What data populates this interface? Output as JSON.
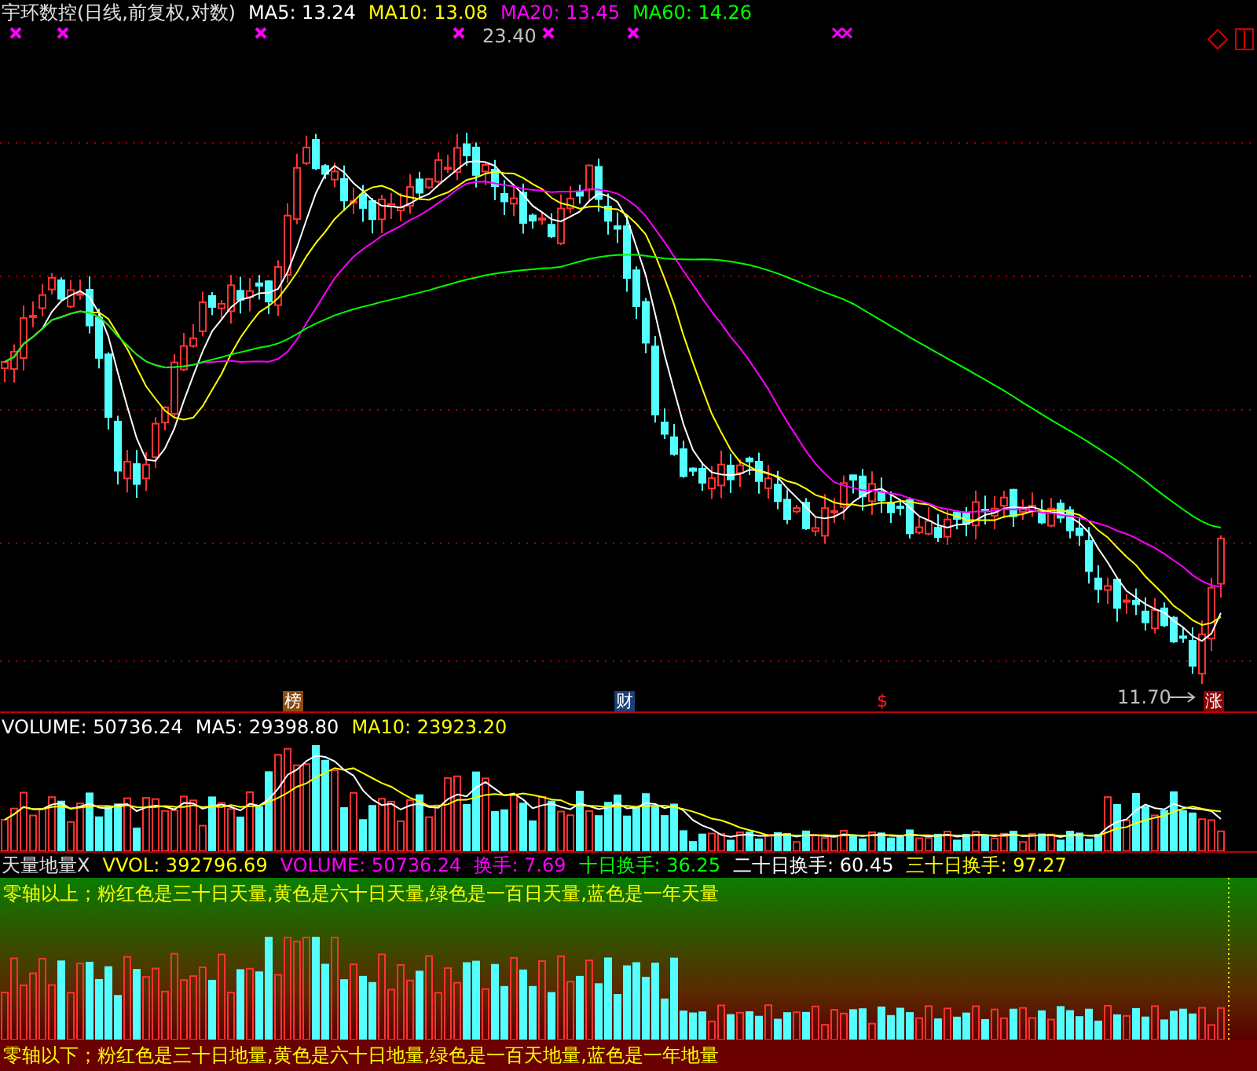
{
  "header": {
    "title": "宇环数控(日线,前复权,对数)",
    "indicators": [
      {
        "label": "MA5: 13.24",
        "color": "#ffffff"
      },
      {
        "label": "MA10: 13.08",
        "color": "#ffff00"
      },
      {
        "label": "MA20: 13.45",
        "color": "#ff00ff"
      },
      {
        "label": "MA60: 14.26",
        "color": "#00ff00"
      }
    ]
  },
  "price_chart": {
    "high_label": "23.40",
    "low_label": "11.70",
    "event_tags": [
      {
        "text": "榜",
        "kind": "boxed",
        "color": "#8b4a10"
      },
      {
        "text": "财",
        "kind": "boxed",
        "color": "#1c3f7a"
      },
      {
        "text": "$",
        "kind": "plain",
        "color": "#ff2020"
      },
      {
        "text": "涨",
        "kind": "boxed",
        "color": "#8b0000"
      }
    ]
  },
  "volume_panel": {
    "indicators": [
      {
        "label": "VOLUME: 50736.24",
        "color": "#ffffff"
      },
      {
        "label": "MA5: 29398.80",
        "color": "#ffffff"
      },
      {
        "label": "MA10: 23923.20",
        "color": "#ffff00"
      }
    ]
  },
  "indicator_panel": {
    "name": "天量地量X",
    "indicators": [
      {
        "label": "VVOL: 392796.69",
        "color": "#ffff00"
      },
      {
        "label": "VOLUME: 50736.24",
        "color": "#ff00ff"
      },
      {
        "label": "换手: 7.69",
        "color": "#ff00ff"
      },
      {
        "label": "十日换手: 36.25",
        "color": "#00ff00"
      },
      {
        "label": "二十日换手: 60.45",
        "color": "#ffffff"
      },
      {
        "label": "三十日换手: 97.27",
        "color": "#ffff00"
      }
    ],
    "top_note": "零轴以上；粉红色是三十日天量,黄色是六十日天量,绿色是一百日天量,蓝色是一年天量",
    "bottom_note": "零轴以下；粉红色是三十日地量,黄色是六十日地量,绿色是一百天地量,蓝色是一年地量"
  }
}
